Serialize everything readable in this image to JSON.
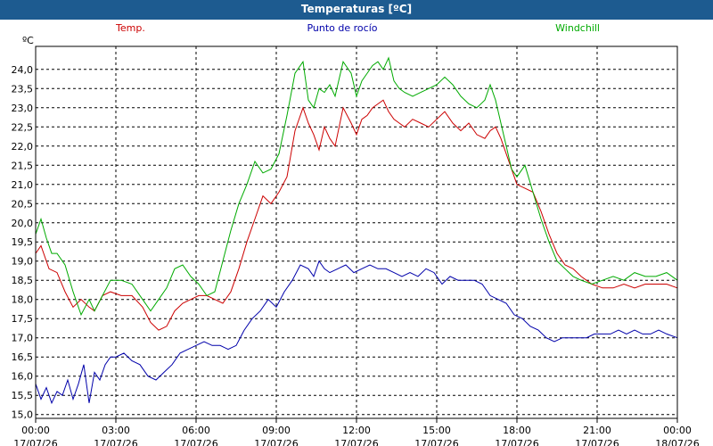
{
  "window": {
    "title": "Temperaturas [ºC]"
  },
  "chart_data": {
    "type": "line",
    "title": "Temperaturas [ºC]",
    "ylabel": "ºC",
    "ylim": [
      14.9,
      24.6
    ],
    "yticks": [
      "15,0",
      "15,5",
      "16,0",
      "16,5",
      "17,0",
      "17,5",
      "18,0",
      "18,5",
      "19,0",
      "19,5",
      "20,0",
      "20,5",
      "21,0",
      "21,5",
      "22,0",
      "22,5",
      "23,0",
      "23,5",
      "24,0"
    ],
    "xlim": [
      0,
      24
    ],
    "xticks": [
      {
        "time": "00:00",
        "date": "17/07/26"
      },
      {
        "time": "03:00",
        "date": "17/07/26"
      },
      {
        "time": "06:00",
        "date": "17/07/26"
      },
      {
        "time": "09:00",
        "date": "17/07/26"
      },
      {
        "time": "12:00",
        "date": "17/07/26"
      },
      {
        "time": "15:00",
        "date": "17/07/26"
      },
      {
        "time": "18:00",
        "date": "17/07/26"
      },
      {
        "time": "21:00",
        "date": "17/07/26"
      },
      {
        "time": "00:00",
        "date": "18/07/26"
      }
    ],
    "grid": true,
    "legend_position": "top",
    "series": [
      {
        "name": "Temp.",
        "color": "#cc0000",
        "x": [
          0,
          0.2,
          0.5,
          0.8,
          1.1,
          1.4,
          1.7,
          2.0,
          2.2,
          2.5,
          2.8,
          3.2,
          3.6,
          4.0,
          4.3,
          4.6,
          4.9,
          5.2,
          5.5,
          5.8,
          6.1,
          6.4,
          6.7,
          7.0,
          7.3,
          7.6,
          7.9,
          8.2,
          8.5,
          8.8,
          9.1,
          9.4,
          9.7,
          10.0,
          10.2,
          10.4,
          10.6,
          10.8,
          11.0,
          11.2,
          11.5,
          11.8,
          12.0,
          12.2,
          12.4,
          12.6,
          12.8,
          13.0,
          13.2,
          13.4,
          13.6,
          13.8,
          14.1,
          14.4,
          14.7,
          15.0,
          15.3,
          15.6,
          15.9,
          16.2,
          16.5,
          16.8,
          17.0,
          17.2,
          17.4,
          17.6,
          17.8,
          18.0,
          18.3,
          18.6,
          18.9,
          19.2,
          19.5,
          19.8,
          20.1,
          20.4,
          20.8,
          21.2,
          21.6,
          22.0,
          22.4,
          22.8,
          23.2,
          23.6,
          24.0
        ],
        "y": [
          19.2,
          19.4,
          18.8,
          18.7,
          18.2,
          17.8,
          18.0,
          17.8,
          17.7,
          18.1,
          18.2,
          18.1,
          18.1,
          17.8,
          17.4,
          17.2,
          17.3,
          17.7,
          17.9,
          18.0,
          18.1,
          18.1,
          18.0,
          17.9,
          18.2,
          18.8,
          19.5,
          20.1,
          20.7,
          20.5,
          20.8,
          21.2,
          22.4,
          23.0,
          22.6,
          22.3,
          21.9,
          22.5,
          22.2,
          22.0,
          23.0,
          22.6,
          22.3,
          22.7,
          22.8,
          23.0,
          23.1,
          23.2,
          22.9,
          22.7,
          22.6,
          22.5,
          22.7,
          22.6,
          22.5,
          22.7,
          22.9,
          22.6,
          22.4,
          22.6,
          22.3,
          22.2,
          22.4,
          22.5,
          22.2,
          21.8,
          21.4,
          21.0,
          20.9,
          20.8,
          20.3,
          19.7,
          19.2,
          18.9,
          18.8,
          18.6,
          18.4,
          18.3,
          18.3,
          18.4,
          18.3,
          18.4,
          18.4,
          18.4,
          18.3
        ]
      },
      {
        "name": "Punto de rocío",
        "color": "#0000aa",
        "x": [
          0,
          0.2,
          0.4,
          0.6,
          0.8,
          1.0,
          1.2,
          1.4,
          1.6,
          1.8,
          2.0,
          2.2,
          2.4,
          2.6,
          2.8,
          3.0,
          3.3,
          3.6,
          3.9,
          4.2,
          4.5,
          4.8,
          5.1,
          5.4,
          5.7,
          6.0,
          6.3,
          6.6,
          6.9,
          7.2,
          7.5,
          7.8,
          8.1,
          8.4,
          8.7,
          9.0,
          9.3,
          9.6,
          9.9,
          10.2,
          10.4,
          10.6,
          10.8,
          11.0,
          11.3,
          11.6,
          11.9,
          12.2,
          12.5,
          12.8,
          13.1,
          13.4,
          13.7,
          14.0,
          14.3,
          14.6,
          14.9,
          15.2,
          15.5,
          15.8,
          16.1,
          16.4,
          16.7,
          17.0,
          17.3,
          17.6,
          17.9,
          18.2,
          18.5,
          18.8,
          19.1,
          19.4,
          19.7,
          20.0,
          20.3,
          20.6,
          20.9,
          21.2,
          21.5,
          21.8,
          22.1,
          22.4,
          22.7,
          23.0,
          23.3,
          23.6,
          24.0
        ],
        "y": [
          15.8,
          15.4,
          15.7,
          15.3,
          15.6,
          15.5,
          15.9,
          15.4,
          15.8,
          16.3,
          15.3,
          16.1,
          15.9,
          16.3,
          16.5,
          16.5,
          16.6,
          16.4,
          16.3,
          16.0,
          15.9,
          16.1,
          16.3,
          16.6,
          16.7,
          16.8,
          16.9,
          16.8,
          16.8,
          16.7,
          16.8,
          17.2,
          17.5,
          17.7,
          18.0,
          17.8,
          18.2,
          18.5,
          18.9,
          18.8,
          18.6,
          19.0,
          18.8,
          18.7,
          18.8,
          18.9,
          18.7,
          18.8,
          18.9,
          18.8,
          18.8,
          18.7,
          18.6,
          18.7,
          18.6,
          18.8,
          18.7,
          18.4,
          18.6,
          18.5,
          18.5,
          18.5,
          18.4,
          18.1,
          18.0,
          17.9,
          17.6,
          17.5,
          17.3,
          17.2,
          17.0,
          16.9,
          17.0,
          17.0,
          17.0,
          17.0,
          17.1,
          17.1,
          17.1,
          17.2,
          17.1,
          17.2,
          17.1,
          17.1,
          17.2,
          17.1,
          17.0
        ]
      },
      {
        "name": "Windchill",
        "color": "#00aa00",
        "x": [
          0,
          0.2,
          0.4,
          0.6,
          0.8,
          1.1,
          1.4,
          1.7,
          2.0,
          2.2,
          2.5,
          2.8,
          3.2,
          3.6,
          4.0,
          4.3,
          4.6,
          4.9,
          5.2,
          5.5,
          5.8,
          6.1,
          6.4,
          6.7,
          7.0,
          7.3,
          7.6,
          7.9,
          8.2,
          8.5,
          8.8,
          9.1,
          9.4,
          9.7,
          10.0,
          10.2,
          10.4,
          10.6,
          10.8,
          11.0,
          11.2,
          11.5,
          11.8,
          12.0,
          12.2,
          12.4,
          12.6,
          12.8,
          13.0,
          13.2,
          13.4,
          13.6,
          13.8,
          14.1,
          14.4,
          14.7,
          15.0,
          15.3,
          15.6,
          15.9,
          16.2,
          16.5,
          16.8,
          17.0,
          17.2,
          17.4,
          17.6,
          17.8,
          18.0,
          18.3,
          18.6,
          18.9,
          19.2,
          19.5,
          19.8,
          20.1,
          20.4,
          20.8,
          21.2,
          21.6,
          22.0,
          22.4,
          22.8,
          23.2,
          23.6,
          24.0
        ],
        "y": [
          19.7,
          20.1,
          19.6,
          19.2,
          19.2,
          18.9,
          18.2,
          17.6,
          18.0,
          17.7,
          18.1,
          18.5,
          18.5,
          18.4,
          18.0,
          17.7,
          18.0,
          18.3,
          18.8,
          18.9,
          18.6,
          18.4,
          18.1,
          18.2,
          19.0,
          19.8,
          20.5,
          21.0,
          21.6,
          21.3,
          21.4,
          21.8,
          22.8,
          23.9,
          24.2,
          23.2,
          23.0,
          23.5,
          23.4,
          23.6,
          23.3,
          24.2,
          23.9,
          23.3,
          23.7,
          23.9,
          24.1,
          24.2,
          24.0,
          24.3,
          23.7,
          23.5,
          23.4,
          23.3,
          23.4,
          23.5,
          23.6,
          23.8,
          23.6,
          23.3,
          23.1,
          23.0,
          23.2,
          23.6,
          23.2,
          22.6,
          22.0,
          21.4,
          21.2,
          21.5,
          20.8,
          20.1,
          19.5,
          19.0,
          18.8,
          18.6,
          18.5,
          18.4,
          18.5,
          18.6,
          18.5,
          18.7,
          18.6,
          18.6,
          18.7,
          18.5
        ]
      }
    ]
  }
}
